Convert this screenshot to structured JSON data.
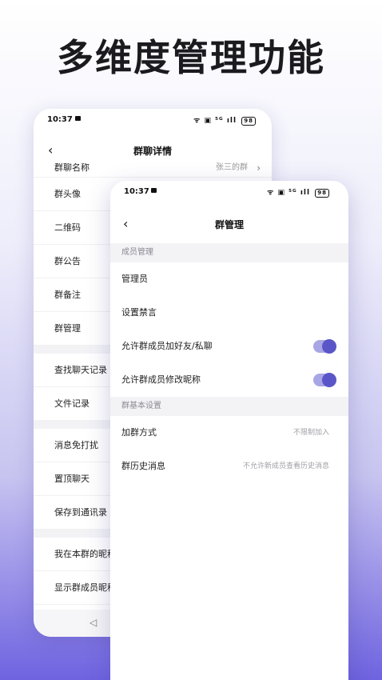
{
  "headline": "多维度管理功能",
  "back_phone": {
    "status": {
      "time": "10:37",
      "signal": "ᯤ ▣ ⁵ᴳ ıll",
      "battery": "98"
    },
    "nav": {
      "back": "‹",
      "title": "群聊详情"
    },
    "group1": [
      {
        "label": "群聊名称",
        "value": "张三的群",
        "chevron": "›"
      },
      {
        "label": "群头像"
      },
      {
        "label": "二维码"
      },
      {
        "label": "群公告"
      },
      {
        "label": "群备注"
      },
      {
        "label": "群管理"
      }
    ],
    "group2": [
      {
        "label": "查找聊天记录"
      },
      {
        "label": "文件记录"
      }
    ],
    "group3": [
      {
        "label": "消息免打扰"
      },
      {
        "label": "置顶聊天"
      },
      {
        "label": "保存到通讯录"
      }
    ],
    "group4": [
      {
        "label": "我在本群的昵称"
      },
      {
        "label": "显示群成员昵称"
      }
    ],
    "bottom_nav": "◁"
  },
  "front_phone": {
    "status": {
      "time": "10:37",
      "signal": "ᯤ ▣ ⁵ᴳ ıll",
      "battery": "98"
    },
    "nav": {
      "back": "‹",
      "title": "群管理"
    },
    "section1": "成员管理",
    "rows1": [
      {
        "label": "管理员"
      },
      {
        "label": "设置禁言"
      },
      {
        "label": "允许群成员加好友/私聊",
        "toggle": true
      },
      {
        "label": "允许群成员修改昵称",
        "toggle": true
      }
    ],
    "section2": "群基本设置",
    "rows2": [
      {
        "label": "加群方式",
        "value": "不限制加入"
      },
      {
        "label": "群历史消息",
        "value": "不允许新成员查看历史消息"
      }
    ]
  }
}
